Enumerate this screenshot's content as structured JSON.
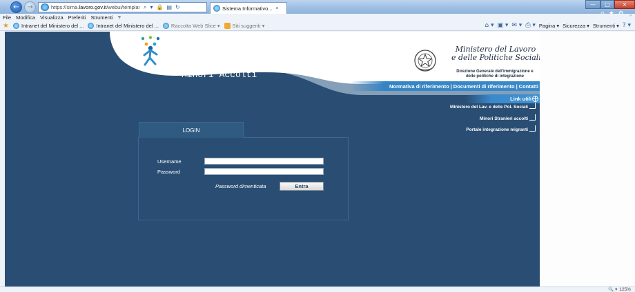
{
  "browser": {
    "url_prefix": "https://sima.",
    "url_domain": "lavoro.gov.it",
    "url_rest": "/webui/template/I",
    "tab_title": "Sistema Informativo...",
    "tab_close": "×",
    "back_glyph": "←",
    "forward_glyph": "→",
    "window_buttons": {
      "minimize": "—",
      "maximize": "□",
      "close": "×"
    },
    "right_icons": [
      "⌂",
      "★",
      "⚙"
    ],
    "menu": [
      "File",
      "Modifica",
      "Visualizza",
      "Preferiti",
      "Strumenti",
      "?"
    ],
    "favorites": [
      {
        "label": "Intranet del Ministero del ...",
        "icon": "ie-icon"
      },
      {
        "label": "Intranet del Ministero del ...",
        "icon": "ie-icon"
      },
      {
        "label": "Raccolta Web Slice ▾",
        "icon": "ie-icon"
      },
      {
        "label": "Siti suggeriti ▾",
        "icon": "rss-icon"
      }
    ],
    "commands": [
      "Pagina ▾",
      "Sicurezza ▾",
      "Strumenti ▾"
    ],
    "command_icons": [
      "⌂ ▾",
      "▣ ▾",
      "✉ ▾",
      "⎙ ▾"
    ],
    "help_icon": "? ▾",
    "scroll_hint": "»",
    "zoom": "125%",
    "zoom_icon": "🔍 ▾"
  },
  "header": {
    "app_title": "Sistema Informativo\nMinori Accolti",
    "ministry_name": "Ministero del Lavoro\ne delle Politiche Sociali",
    "ministry_dept": "Direzione Generale dell'immigrazione e\ndelle politiche di integrazione"
  },
  "topnav": {
    "items": [
      "Normativa di riferimento",
      "Documenti di riferimento",
      "Contatti"
    ],
    "separator": "|"
  },
  "links": {
    "title": "Link utili",
    "items": [
      "Ministero del Lav. e delle Pol. Sociali",
      "Minori Stranieri accolti",
      "Portale integrazione migranti"
    ]
  },
  "login": {
    "tab_label": "LOGIN",
    "username_label": "Username",
    "password_label": "Password",
    "username_value": "",
    "password_value": "",
    "forgot_label": "Password dimenticata",
    "submit_label": "Entra"
  },
  "colors": {
    "page_background": "#2a4e73",
    "nav_accent": "#3a8acb",
    "header_white": "#ffffff"
  }
}
